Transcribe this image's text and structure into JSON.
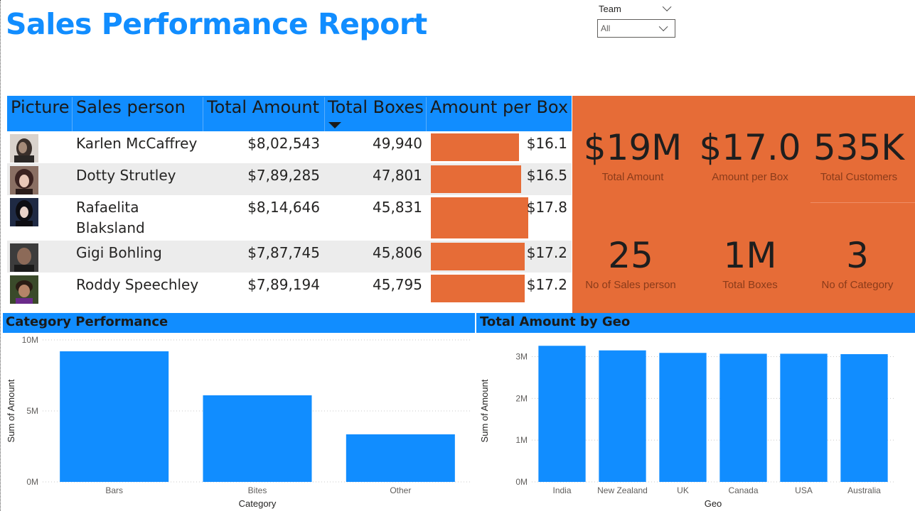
{
  "title": "Sales Performance Report",
  "slicer": {
    "label": "Team",
    "value": "All"
  },
  "table": {
    "headers": [
      "Picture",
      "Sales person",
      "Total Amount",
      "Total Boxes",
      "Amount per Box"
    ],
    "rows": [
      {
        "name": "Karlen McCaffrey",
        "amount": "$8,02,543",
        "boxes": "49,940",
        "per_box": "$16.1",
        "per_box_value": 16.1
      },
      {
        "name": "Dotty Strutley",
        "amount": "$7,89,285",
        "boxes": "47,801",
        "per_box": "$16.5",
        "per_box_value": 16.5
      },
      {
        "name": "Rafaelita",
        "name2": "Blaksland",
        "amount": "$8,14,646",
        "boxes": "45,831",
        "per_box": "$17.8",
        "per_box_value": 17.8
      },
      {
        "name": "Gigi Bohling",
        "amount": "$7,87,745",
        "boxes": "45,806",
        "per_box": "$17.2",
        "per_box_value": 17.2
      },
      {
        "name": "Roddy Speechley",
        "amount": "$7,89,194",
        "boxes": "45,795",
        "per_box": "$17.2",
        "per_box_value": 17.2
      }
    ]
  },
  "kpis": [
    {
      "value": "$19M",
      "label": "Total Amount"
    },
    {
      "value": "$17.0",
      "label": "Amount per Box"
    },
    {
      "value": "535K",
      "label": "Total Customers"
    },
    {
      "value": "25",
      "label": "No of Sales person"
    },
    {
      "value": "1M",
      "label": "Total Boxes"
    },
    {
      "value": "3",
      "label": "No of Category"
    }
  ],
  "colors": {
    "accent": "#118DFF",
    "kpi_bg": "#E66C37",
    "bar": "#E66C37"
  },
  "chart_data": [
    {
      "type": "bar",
      "title": "Category Performance",
      "categories": [
        "Bars",
        "Bites",
        "Other"
      ],
      "values": [
        9200000,
        6100000,
        3350000
      ],
      "xlabel": "Category",
      "ylabel": "Sum of Amount",
      "ylim": [
        0,
        10000000
      ],
      "yticks": [
        "0M",
        "5M",
        "10M"
      ],
      "grid": true
    },
    {
      "type": "bar",
      "title": "Total Amount by Geo",
      "categories": [
        "India",
        "New Zealand",
        "UK",
        "Canada",
        "USA",
        "Australia"
      ],
      "values": [
        3260000,
        3150000,
        3090000,
        3070000,
        3070000,
        3060000
      ],
      "xlabel": "Geo",
      "ylabel": "Sum of Amount",
      "ylim": [
        0,
        3400000
      ],
      "yticks": [
        "0M",
        "1M",
        "2M",
        "3M"
      ],
      "grid": true
    }
  ]
}
